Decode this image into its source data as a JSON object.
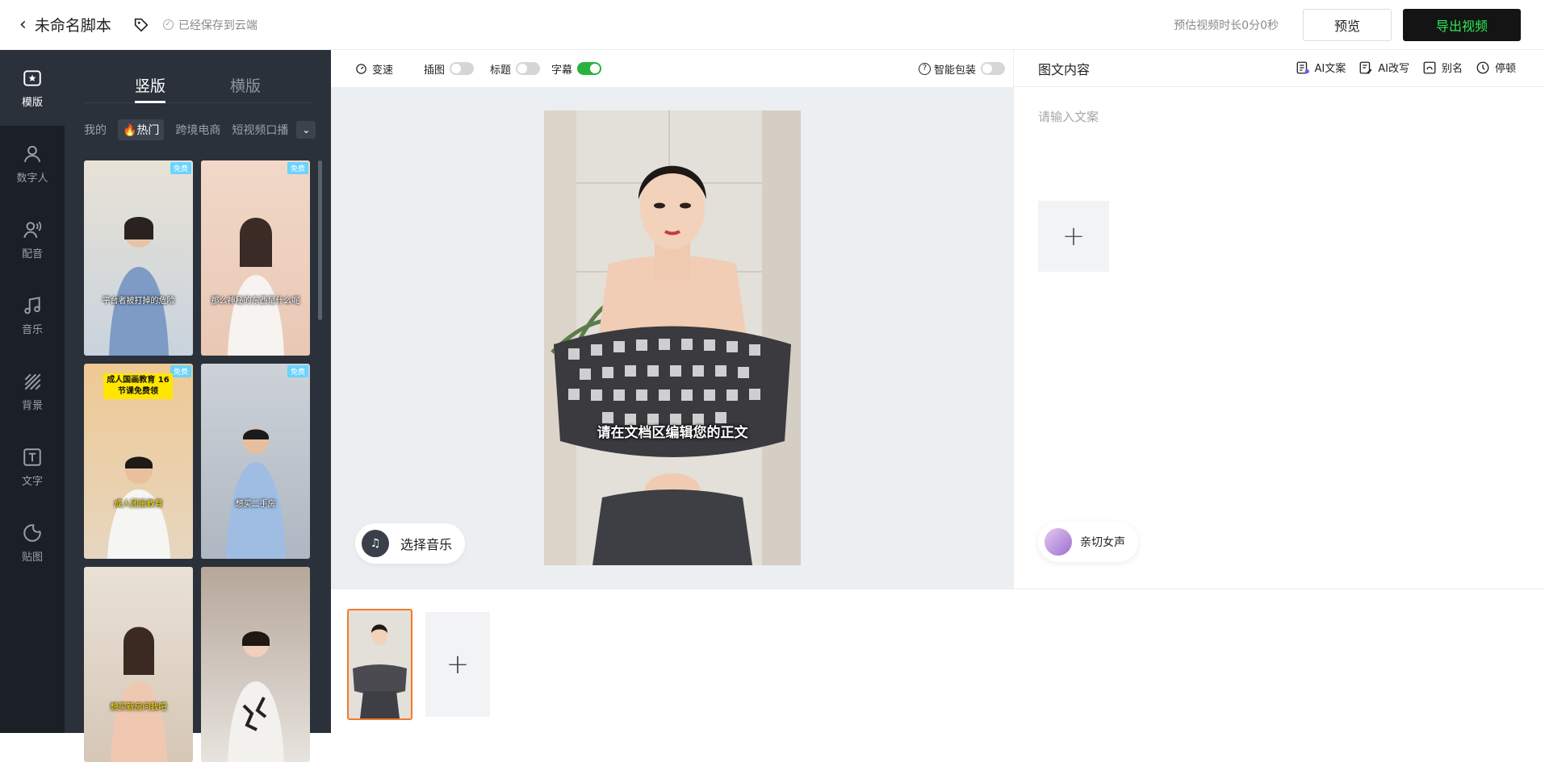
{
  "header": {
    "back_label": "未命名脚本",
    "saved_status": "已经保存到云端",
    "estimate": "预估视频时长0分0秒",
    "preview_label": "预览",
    "export_label": "导出视频"
  },
  "nav": {
    "items": [
      {
        "label": "模版",
        "icon": "template-icon"
      },
      {
        "label": "数字人",
        "icon": "avatar-person-icon"
      },
      {
        "label": "配音",
        "icon": "voice-icon"
      },
      {
        "label": "音乐",
        "icon": "music-icon"
      },
      {
        "label": "背景",
        "icon": "background-icon"
      },
      {
        "label": "文字",
        "icon": "text-icon"
      },
      {
        "label": "贴图",
        "icon": "sticker-icon"
      }
    ]
  },
  "panel": {
    "tabs": [
      "竖版",
      "横版"
    ],
    "categories": [
      "我的",
      "🔥热门",
      "跨境电商",
      "短视频口播"
    ],
    "templates": [
      {
        "badge": "免费",
        "caption": "平台者被打掉的危险",
        "highlight": ""
      },
      {
        "badge": "免费",
        "caption": "那么神秘的东西是什么呢",
        "highlight": ""
      },
      {
        "badge": "免费",
        "caption": "成人团画教育",
        "highlight": "成人国画教育 16节课免费领"
      },
      {
        "badge": "免费",
        "caption": "想买二手房",
        "highlight": ""
      },
      {
        "badge": "",
        "caption": "想买新房问我吧",
        "highlight": ""
      },
      {
        "badge": "",
        "caption": "",
        "highlight": ""
      }
    ]
  },
  "toolbar": {
    "speed_label": "变速",
    "insert_label": "插图",
    "title_label": "标题",
    "subtitle_label": "字幕",
    "smart_label": "智能包装"
  },
  "canvas": {
    "subtitle": "请在文档区编辑您的正文",
    "music_label": "选择音乐"
  },
  "right": {
    "title": "图文内容",
    "tools": [
      "AI文案",
      "AI改写",
      "别名",
      "停顿"
    ],
    "placeholder": "请输入文案",
    "voice_label": "亲切女声"
  },
  "colors": {
    "accent_green": "#2cea54",
    "toggle_on": "#2ab23e",
    "scene_border": "#f07c2b",
    "sidebar_bg": "#1b1f26",
    "panel_bg": "#2b313b"
  }
}
